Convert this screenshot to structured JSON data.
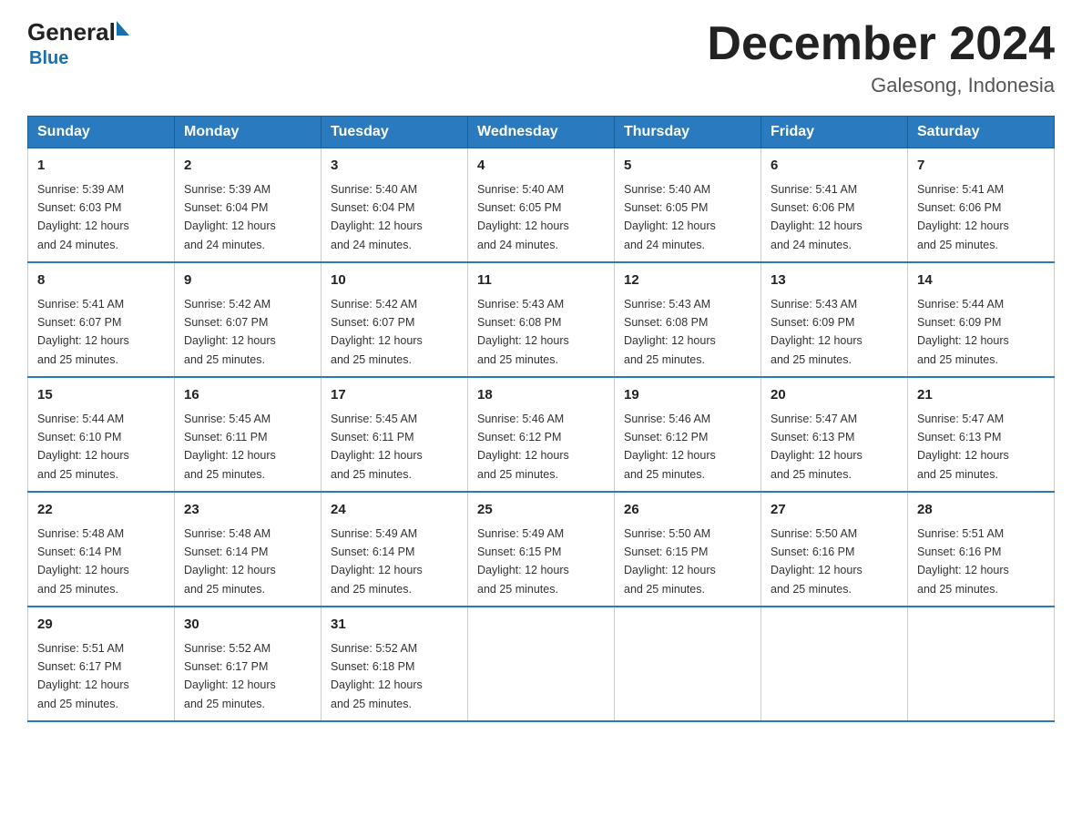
{
  "header": {
    "logo_general": "General",
    "logo_blue": "Blue",
    "month_title": "December 2024",
    "location": "Galesong, Indonesia"
  },
  "days_of_week": [
    "Sunday",
    "Monday",
    "Tuesday",
    "Wednesday",
    "Thursday",
    "Friday",
    "Saturday"
  ],
  "weeks": [
    [
      {
        "day": "1",
        "sunrise": "5:39 AM",
        "sunset": "6:03 PM",
        "daylight": "12 hours and 24 minutes."
      },
      {
        "day": "2",
        "sunrise": "5:39 AM",
        "sunset": "6:04 PM",
        "daylight": "12 hours and 24 minutes."
      },
      {
        "day": "3",
        "sunrise": "5:40 AM",
        "sunset": "6:04 PM",
        "daylight": "12 hours and 24 minutes."
      },
      {
        "day": "4",
        "sunrise": "5:40 AM",
        "sunset": "6:05 PM",
        "daylight": "12 hours and 24 minutes."
      },
      {
        "day": "5",
        "sunrise": "5:40 AM",
        "sunset": "6:05 PM",
        "daylight": "12 hours and 24 minutes."
      },
      {
        "day": "6",
        "sunrise": "5:41 AM",
        "sunset": "6:06 PM",
        "daylight": "12 hours and 24 minutes."
      },
      {
        "day": "7",
        "sunrise": "5:41 AM",
        "sunset": "6:06 PM",
        "daylight": "12 hours and 25 minutes."
      }
    ],
    [
      {
        "day": "8",
        "sunrise": "5:41 AM",
        "sunset": "6:07 PM",
        "daylight": "12 hours and 25 minutes."
      },
      {
        "day": "9",
        "sunrise": "5:42 AM",
        "sunset": "6:07 PM",
        "daylight": "12 hours and 25 minutes."
      },
      {
        "day": "10",
        "sunrise": "5:42 AM",
        "sunset": "6:07 PM",
        "daylight": "12 hours and 25 minutes."
      },
      {
        "day": "11",
        "sunrise": "5:43 AM",
        "sunset": "6:08 PM",
        "daylight": "12 hours and 25 minutes."
      },
      {
        "day": "12",
        "sunrise": "5:43 AM",
        "sunset": "6:08 PM",
        "daylight": "12 hours and 25 minutes."
      },
      {
        "day": "13",
        "sunrise": "5:43 AM",
        "sunset": "6:09 PM",
        "daylight": "12 hours and 25 minutes."
      },
      {
        "day": "14",
        "sunrise": "5:44 AM",
        "sunset": "6:09 PM",
        "daylight": "12 hours and 25 minutes."
      }
    ],
    [
      {
        "day": "15",
        "sunrise": "5:44 AM",
        "sunset": "6:10 PM",
        "daylight": "12 hours and 25 minutes."
      },
      {
        "day": "16",
        "sunrise": "5:45 AM",
        "sunset": "6:11 PM",
        "daylight": "12 hours and 25 minutes."
      },
      {
        "day": "17",
        "sunrise": "5:45 AM",
        "sunset": "6:11 PM",
        "daylight": "12 hours and 25 minutes."
      },
      {
        "day": "18",
        "sunrise": "5:46 AM",
        "sunset": "6:12 PM",
        "daylight": "12 hours and 25 minutes."
      },
      {
        "day": "19",
        "sunrise": "5:46 AM",
        "sunset": "6:12 PM",
        "daylight": "12 hours and 25 minutes."
      },
      {
        "day": "20",
        "sunrise": "5:47 AM",
        "sunset": "6:13 PM",
        "daylight": "12 hours and 25 minutes."
      },
      {
        "day": "21",
        "sunrise": "5:47 AM",
        "sunset": "6:13 PM",
        "daylight": "12 hours and 25 minutes."
      }
    ],
    [
      {
        "day": "22",
        "sunrise": "5:48 AM",
        "sunset": "6:14 PM",
        "daylight": "12 hours and 25 minutes."
      },
      {
        "day": "23",
        "sunrise": "5:48 AM",
        "sunset": "6:14 PM",
        "daylight": "12 hours and 25 minutes."
      },
      {
        "day": "24",
        "sunrise": "5:49 AM",
        "sunset": "6:14 PM",
        "daylight": "12 hours and 25 minutes."
      },
      {
        "day": "25",
        "sunrise": "5:49 AM",
        "sunset": "6:15 PM",
        "daylight": "12 hours and 25 minutes."
      },
      {
        "day": "26",
        "sunrise": "5:50 AM",
        "sunset": "6:15 PM",
        "daylight": "12 hours and 25 minutes."
      },
      {
        "day": "27",
        "sunrise": "5:50 AM",
        "sunset": "6:16 PM",
        "daylight": "12 hours and 25 minutes."
      },
      {
        "day": "28",
        "sunrise": "5:51 AM",
        "sunset": "6:16 PM",
        "daylight": "12 hours and 25 minutes."
      }
    ],
    [
      {
        "day": "29",
        "sunrise": "5:51 AM",
        "sunset": "6:17 PM",
        "daylight": "12 hours and 25 minutes."
      },
      {
        "day": "30",
        "sunrise": "5:52 AM",
        "sunset": "6:17 PM",
        "daylight": "12 hours and 25 minutes."
      },
      {
        "day": "31",
        "sunrise": "5:52 AM",
        "sunset": "6:18 PM",
        "daylight": "12 hours and 25 minutes."
      },
      null,
      null,
      null,
      null
    ]
  ],
  "labels": {
    "sunrise": "Sunrise:",
    "sunset": "Sunset:",
    "daylight": "Daylight:"
  }
}
